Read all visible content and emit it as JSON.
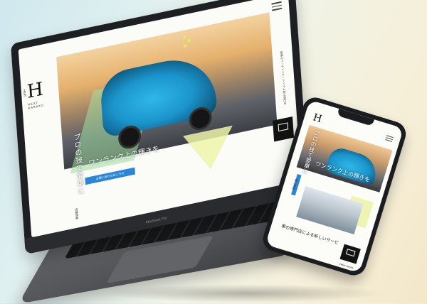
{
  "laptop": {
    "model_label": "MacBook Pro",
    "site": {
      "logo_mark": "H",
      "logo_sub": "HEAT KARAKU",
      "logo_side": "HEAT",
      "headline": "プロの技で愛車に",
      "rank_line": "ワンランク上の輝きを",
      "button_label": "お問い合わせはこちら",
      "side_text": "愛車のコーティング・フィルム施工専門店",
      "info_text": "店舗情報"
    }
  },
  "phone": {
    "site": {
      "logo_mark": "H",
      "headline": "プロの技で愛車に",
      "rank_line": "ワンランク上の輝きを",
      "vert_text": "施工事例",
      "caption": "車の専門店による新しいサービ",
      "more_label": "view more"
    }
  },
  "colors": {
    "accent_blue": "#2a86d6",
    "car_blue": "#1b95cc",
    "lime": "#d8f060",
    "soft_green": "#a0dca0",
    "device_dark": "#1e1f22"
  },
  "icons": {
    "menu": "hamburger-menu-icon",
    "contact": "window-icon"
  }
}
